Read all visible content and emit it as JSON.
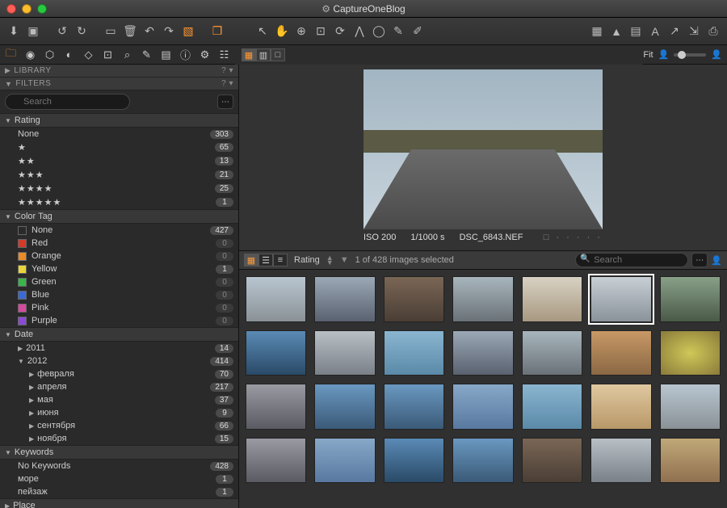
{
  "title": "CaptureOneBlog",
  "fit_label": "Fit",
  "panels": {
    "library": "LIBRARY",
    "filters": "FILTERS"
  },
  "search": {
    "placeholder": "Search"
  },
  "sections": {
    "rating": {
      "title": "Rating",
      "rows": [
        {
          "label": "None",
          "count": "303",
          "stars": 0
        },
        {
          "label": "",
          "count": "65",
          "stars": 1
        },
        {
          "label": "",
          "count": "13",
          "stars": 2
        },
        {
          "label": "",
          "count": "21",
          "stars": 3
        },
        {
          "label": "",
          "count": "25",
          "stars": 4
        },
        {
          "label": "",
          "count": "1",
          "stars": 5
        }
      ]
    },
    "color_tag": {
      "title": "Color Tag",
      "rows": [
        {
          "label": "None",
          "count": "427",
          "color": "#2a2a2a"
        },
        {
          "label": "Red",
          "count": "0",
          "color": "#d43a2a"
        },
        {
          "label": "Orange",
          "count": "0",
          "color": "#e88b2a"
        },
        {
          "label": "Yellow",
          "count": "1",
          "color": "#e8d43a"
        },
        {
          "label": "Green",
          "count": "0",
          "color": "#3ab54a"
        },
        {
          "label": "Blue",
          "count": "0",
          "color": "#3a6ad4"
        },
        {
          "label": "Pink",
          "count": "0",
          "color": "#d44aa0"
        },
        {
          "label": "Purple",
          "count": "0",
          "color": "#8a4ad4"
        }
      ]
    },
    "date": {
      "title": "Date",
      "rows": [
        {
          "label": "2011",
          "count": "14",
          "sub": false
        },
        {
          "label": "2012",
          "count": "414",
          "sub": false,
          "expanded": true
        },
        {
          "label": "февраля",
          "count": "70",
          "sub": true
        },
        {
          "label": "апреля",
          "count": "217",
          "sub": true
        },
        {
          "label": "мая",
          "count": "37",
          "sub": true
        },
        {
          "label": "июня",
          "count": "9",
          "sub": true
        },
        {
          "label": "сентября",
          "count": "66",
          "sub": true
        },
        {
          "label": "ноября",
          "count": "15",
          "sub": true
        }
      ]
    },
    "keywords": {
      "title": "Keywords",
      "rows": [
        {
          "label": "No Keywords",
          "count": "428"
        },
        {
          "label": "море",
          "count": "1"
        },
        {
          "label": "пейзаж",
          "count": "1"
        }
      ]
    },
    "place": {
      "title": "Place"
    }
  },
  "meta": {
    "iso": "ISO 200",
    "shutter": "1/1000 s",
    "filename": "DSC_6843.NEF"
  },
  "browser_bar": {
    "sort": "Rating",
    "status": "1 of 428 images selected",
    "search_placeholder": "Search"
  },
  "thumb_hues": [
    "a",
    "b",
    "c",
    "d",
    "e",
    "f",
    "g",
    "h",
    "i",
    "j",
    "b",
    "d",
    "k",
    "l",
    "m",
    "n",
    "n",
    "p",
    "j",
    "o",
    "a",
    "m",
    "p",
    "h",
    "n",
    "c",
    "i",
    "q"
  ]
}
